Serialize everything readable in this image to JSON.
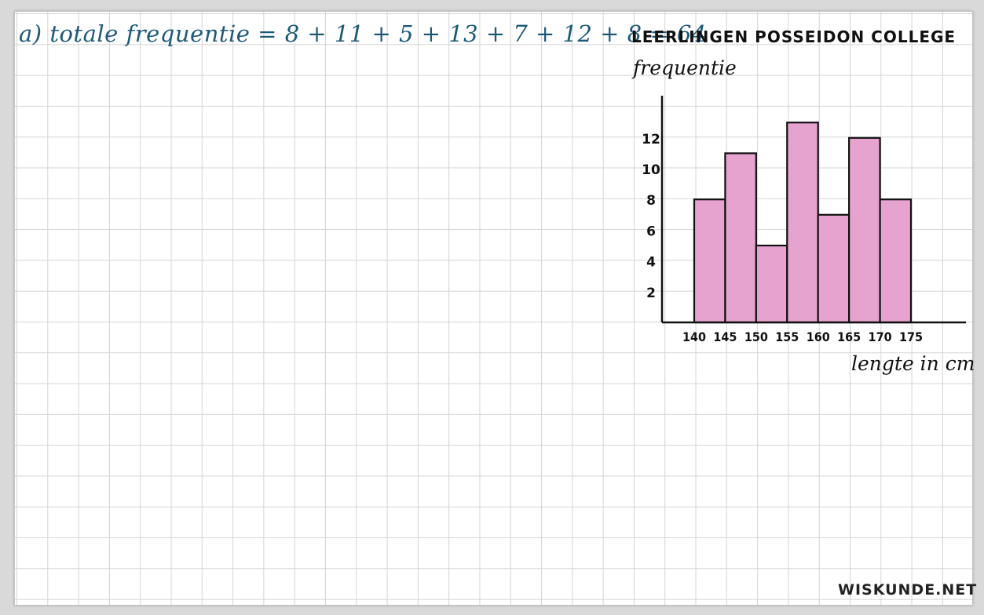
{
  "equation": "a) totale frequentie = 8 + 11 + 5 + 13 + 7 + 12 + 8 = 64",
  "watermark": "WISKUNDE.NET",
  "colors": {
    "bar_fill": "#e7a3cf",
    "bar_stroke": "#111111",
    "equation_ink": "#1d5a78"
  },
  "chart_data": {
    "type": "bar",
    "title": "LEERLINGEN POSSEIDON COLLEGE",
    "xlabel": "lengte in cm",
    "ylabel": "frequentie",
    "x_edges": [
      140,
      145,
      150,
      155,
      160,
      165,
      170,
      175
    ],
    "x_tick_labels": [
      "140",
      "145",
      "150",
      "155",
      "160",
      "165",
      "170",
      "175"
    ],
    "values": [
      8,
      11,
      5,
      13,
      7,
      12,
      8
    ],
    "y_ticks": [
      2,
      4,
      6,
      8,
      10,
      12
    ],
    "ylim": [
      0,
      14.5
    ],
    "grid": false
  }
}
